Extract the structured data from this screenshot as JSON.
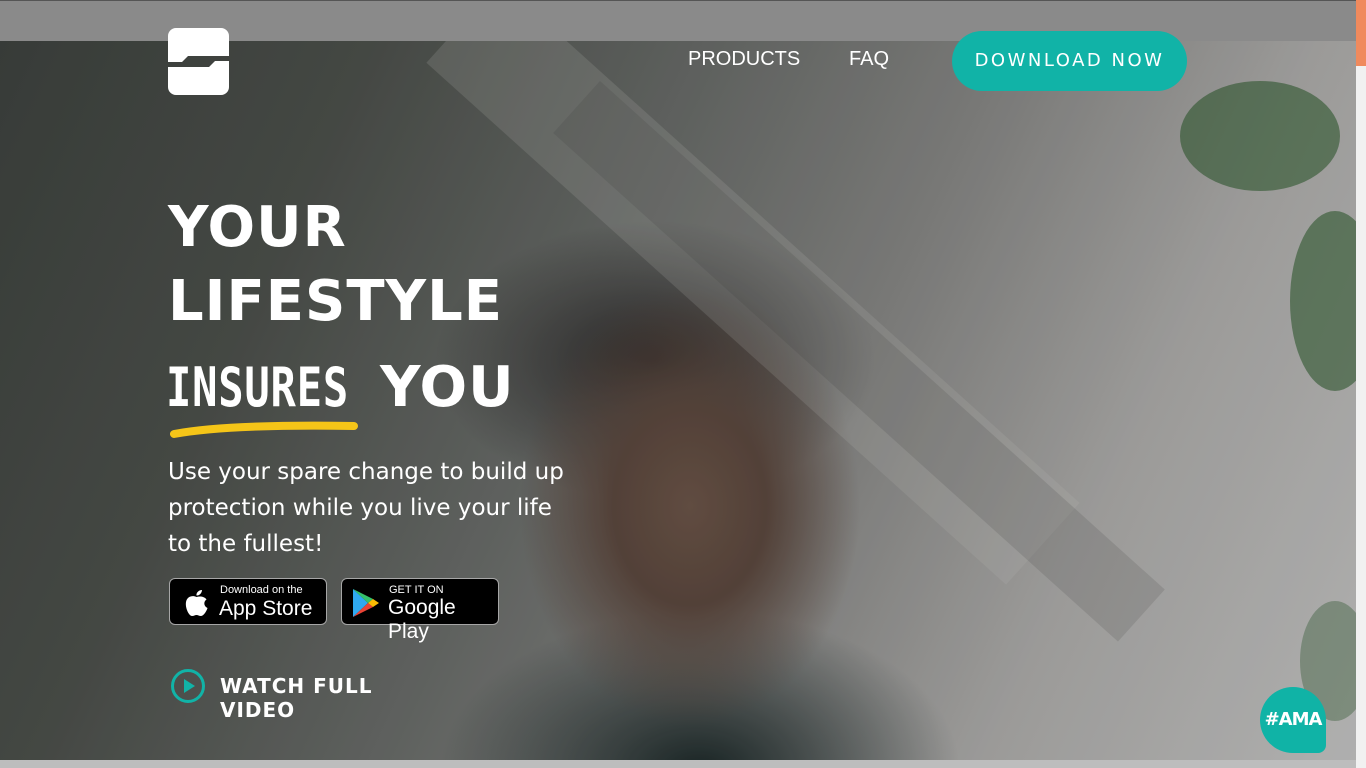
{
  "nav": {
    "products": "PRODUCTS",
    "faq": "FAQ",
    "download": "DOWNLOAD NOW"
  },
  "hero": {
    "line1": "YOUR",
    "line2": "LIFESTYLE",
    "line3_highlight": "INSURES",
    "line3_rest": "YOU",
    "subtext": "Use your spare change to build up protection while you live your life to the fullest!"
  },
  "badges": {
    "app_store_small": "Download on the",
    "app_store_big": "App Store",
    "google_small": "GET IT ON",
    "google_big": "Google Play"
  },
  "video": {
    "label": "WATCH FULL VIDEO"
  },
  "chat": {
    "label": "#AMA"
  },
  "colors": {
    "accent": "#11b3a7",
    "underline": "#f5c518",
    "scroll_thumb": "#f08a5d"
  }
}
